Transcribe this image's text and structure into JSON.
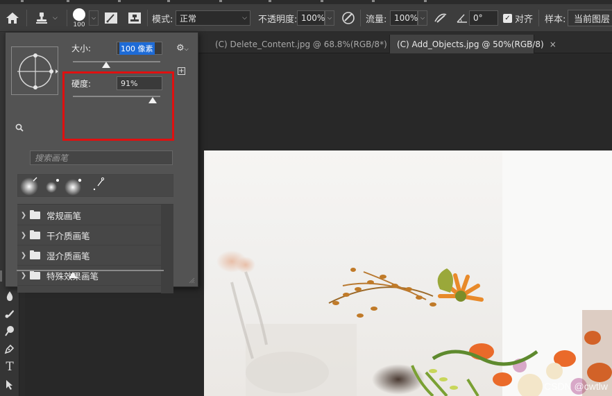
{
  "options_bar": {
    "brush_size": "100",
    "mode_label": "模式:",
    "mode_value": "正常",
    "opacity_label": "不透明度:",
    "opacity_value": "100%",
    "flow_label": "流量:",
    "flow_value": "100%",
    "angle_value": "0°",
    "align_label": "对齐",
    "align_checked": true,
    "sample_label": "样本:",
    "sample_value": "当前图层"
  },
  "tabs": [
    {
      "label": "(C) Delete_Content.jpg @ 68.8%(RGB/8*) *",
      "active": false
    },
    {
      "label": "(C) Add_Objects.jpg @ 50%(RGB/8)",
      "active": true
    }
  ],
  "brush_panel": {
    "size_label": "大小:",
    "size_value": "100 像素",
    "size_fraction": 0.38,
    "hardness_label": "硬度:",
    "hardness_value": "91%",
    "hardness": 0.91,
    "search_placeholder": "搜索画笔",
    "groups": [
      {
        "label": "常规画笔"
      },
      {
        "label": "干介质画笔"
      },
      {
        "label": "湿介质画笔"
      },
      {
        "label": "特殊效果画笔"
      }
    ]
  },
  "watermark": "CSDN @cwtlw",
  "colors": {
    "highlight_box": "#e01010",
    "selection": "#1e6bd6",
    "panel_bg": "#535353"
  },
  "icons": [
    "home-icon",
    "clone-stamp-icon",
    "brush-preset-icon",
    "toggle-brush-panel-icon",
    "toggle-clone-source-icon",
    "pressure-opacity-icon",
    "pressure-flow-icon",
    "angle-icon",
    "gear-icon",
    "new-brush-icon",
    "search-icon",
    "folder-icon",
    "chevron-right-icon",
    "close-icon"
  ]
}
